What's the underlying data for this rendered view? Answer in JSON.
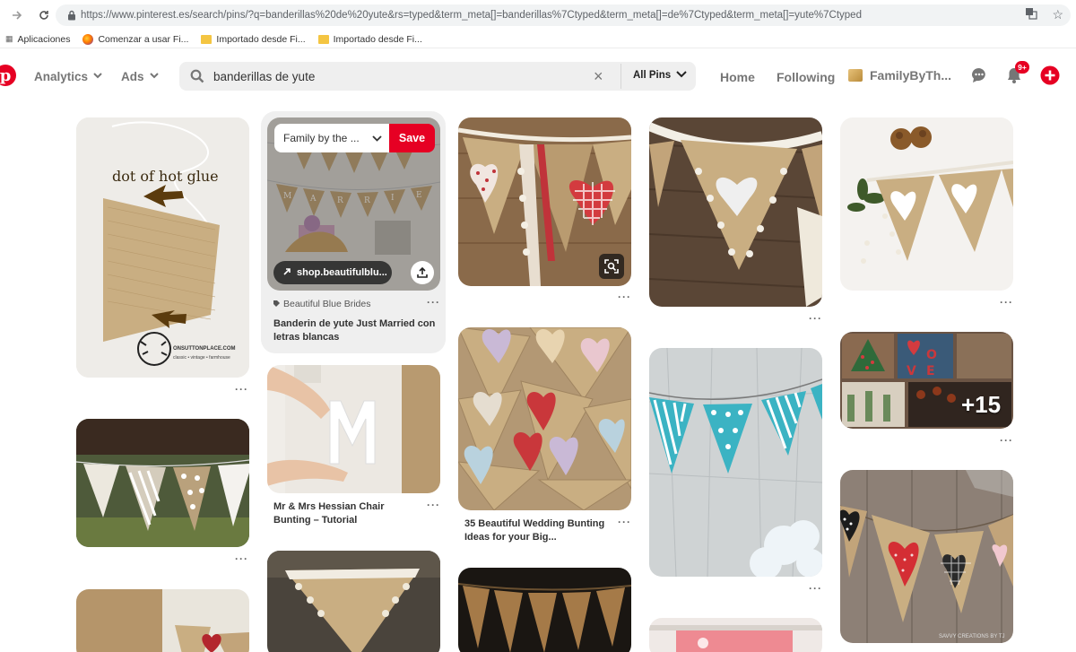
{
  "browser": {
    "url": "https://www.pinterest.es/search/pins/?q=banderillas%20de%20yute&rs=typed&term_meta[]=banderillas%7Ctyped&term_meta[]=de%7Ctyped&term_meta[]=yute%7Ctyped",
    "bookmarks": [
      {
        "label": "Aplicaciones",
        "icon": "apps-icon"
      },
      {
        "label": "Comenzar a usar Fi...",
        "icon": "firefox-icon"
      },
      {
        "label": "Importado desde Fi...",
        "icon": "folder-icon"
      },
      {
        "label": "Importado desde Fi...",
        "icon": "folder-icon"
      }
    ]
  },
  "header": {
    "analytics": "Analytics",
    "ads": "Ads",
    "search_value": "banderillas de yute",
    "scope": "All Pins",
    "home": "Home",
    "following": "Following",
    "user": "FamilyByTh...",
    "notifications_badge": "9+"
  },
  "hover_pin": {
    "board": "Family by the ...",
    "save": "Save",
    "link": "shop.beautifulblu...",
    "source": "Beautiful Blue Brides",
    "title": "Banderin de yute Just Married con letras blancas"
  },
  "pins": {
    "glue_text": "dot of hot glue",
    "glue_brand": "ONSUTTONPLACE.COM",
    "glue_tag": "classic • vintage • farmhouse",
    "hessian_title": "Mr & Mrs Hessian Chair Bunting – Tutorial",
    "wedding_title": "35 Beautiful Wedding Bunting Ideas for your Big...",
    "more_count": "+15",
    "watermark": "SAVVY CREATIONS BY TJ",
    "dots": "···"
  },
  "colors": {
    "brand_red": "#e60023",
    "burlap": "#c7a97a",
    "teal": "#3bb3c3"
  }
}
